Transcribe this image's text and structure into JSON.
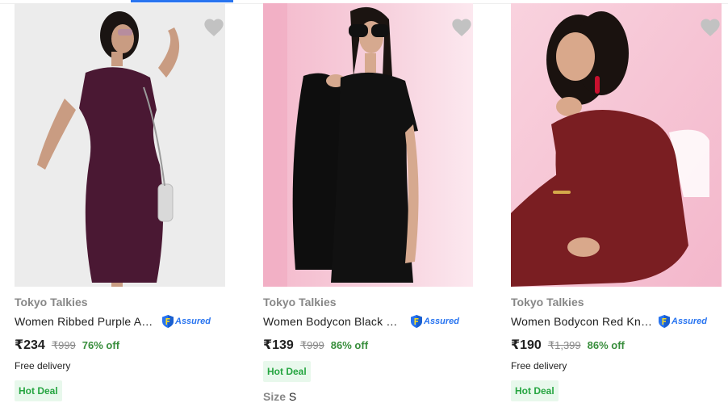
{
  "products": [
    {
      "brand": "Tokyo Talkies",
      "title": "Women Ribbed Purple Ab...",
      "assured": "Assured",
      "price": "₹234",
      "mrp": "₹999",
      "discount": "76% off",
      "delivery": "Free delivery",
      "badge": "Hot Deal",
      "dress_color": "#4a1833",
      "bg_color": "#eeeeee"
    },
    {
      "brand": "Tokyo Talkies",
      "title": "Women Bodycon Black Mi...",
      "assured": "Assured",
      "price": "₹139",
      "mrp": "₹999",
      "discount": "86% off",
      "badge": "Hot Deal",
      "size_label": "Size",
      "size_value": "S",
      "dress_color": "#111111",
      "bg_color": "#f3c9d6"
    },
    {
      "brand": "Tokyo Talkies",
      "title": "Women Bodycon Red Kne...",
      "assured": "Assured",
      "price": "₹190",
      "mrp": "₹1,399",
      "discount": "86% off",
      "delivery": "Free delivery",
      "badge": "Hot Deal",
      "dress_color": "#7a1e22",
      "bg_color": "#f6c6d6"
    }
  ],
  "colors": {
    "accent": "#2874f0",
    "discount_green": "#388e3c",
    "muted": "#878787",
    "wishlist": "#c2c2c2"
  }
}
